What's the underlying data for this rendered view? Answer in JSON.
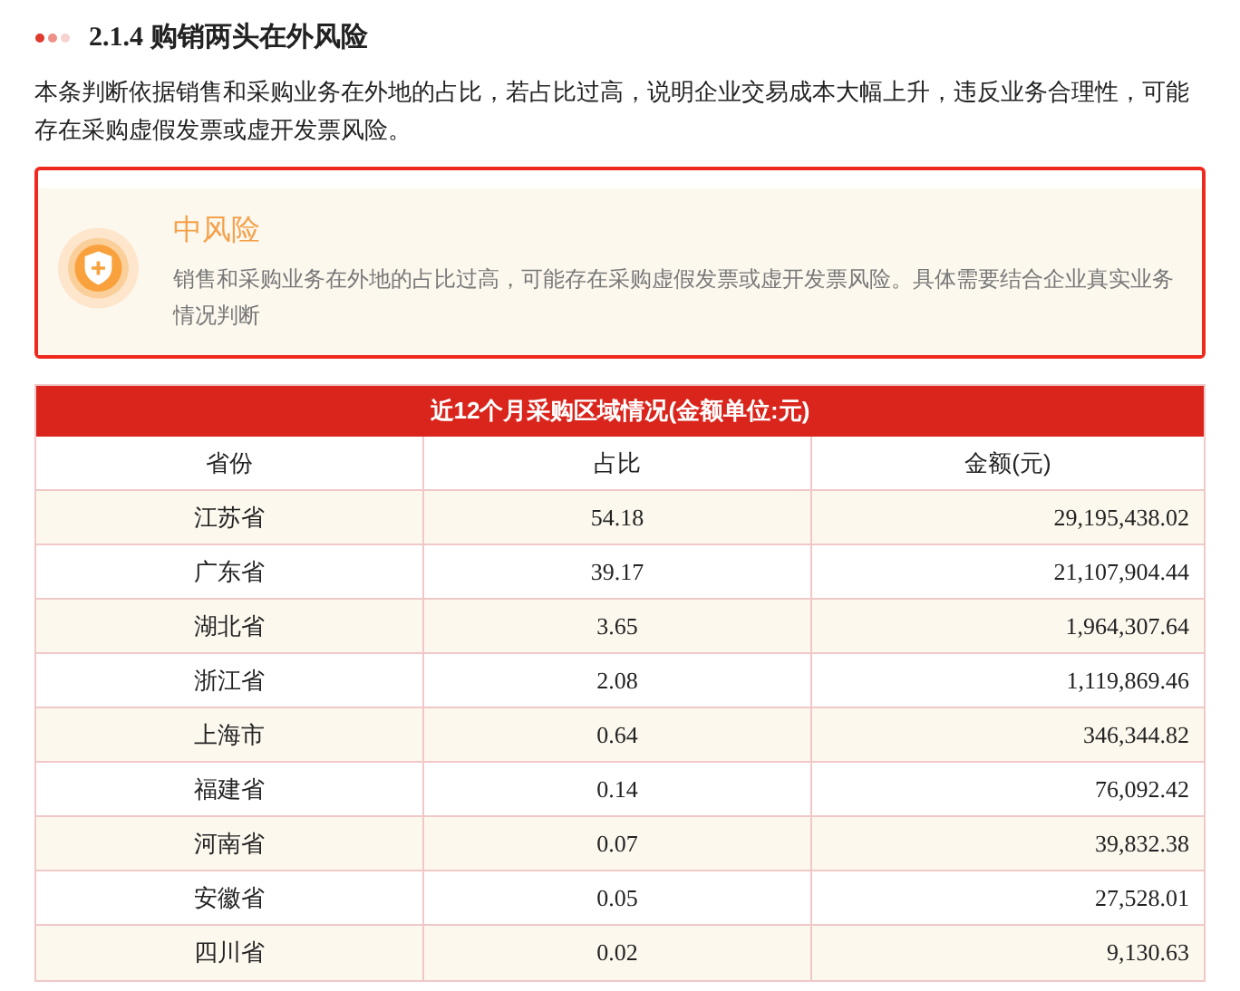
{
  "section": {
    "number": "2.1.4",
    "title": "购销两头在外风险"
  },
  "description": "本条判断依据销售和采购业务在外地的占比，若占比过高，说明企业交易成本大幅上升，违反业务合理性，可能存在采购虚假发票或虚开发票风险。",
  "alert": {
    "level": "中风险",
    "message": "销售和采购业务在外地的占比过高，可能存在采购虚假发票或虚开发票风险。具体需要结合企业真实业务情况判断"
  },
  "table": {
    "title": "近12个月采购区域情况(金额单位:元)",
    "columns": [
      "省份",
      "占比",
      "金额(元)"
    ],
    "rows": [
      [
        "江苏省",
        "54.18",
        "29,195,438.02"
      ],
      [
        "广东省",
        "39.17",
        "21,107,904.44"
      ],
      [
        "湖北省",
        "3.65",
        "1,964,307.64"
      ],
      [
        "浙江省",
        "2.08",
        "1,119,869.46"
      ],
      [
        "上海市",
        "0.64",
        "346,344.82"
      ],
      [
        "福建省",
        "0.14",
        "76,092.42"
      ],
      [
        "河南省",
        "0.07",
        "39,832.38"
      ],
      [
        "安徽省",
        "0.05",
        "27,528.01"
      ],
      [
        "四川省",
        "0.02",
        "9,130.63"
      ]
    ]
  }
}
